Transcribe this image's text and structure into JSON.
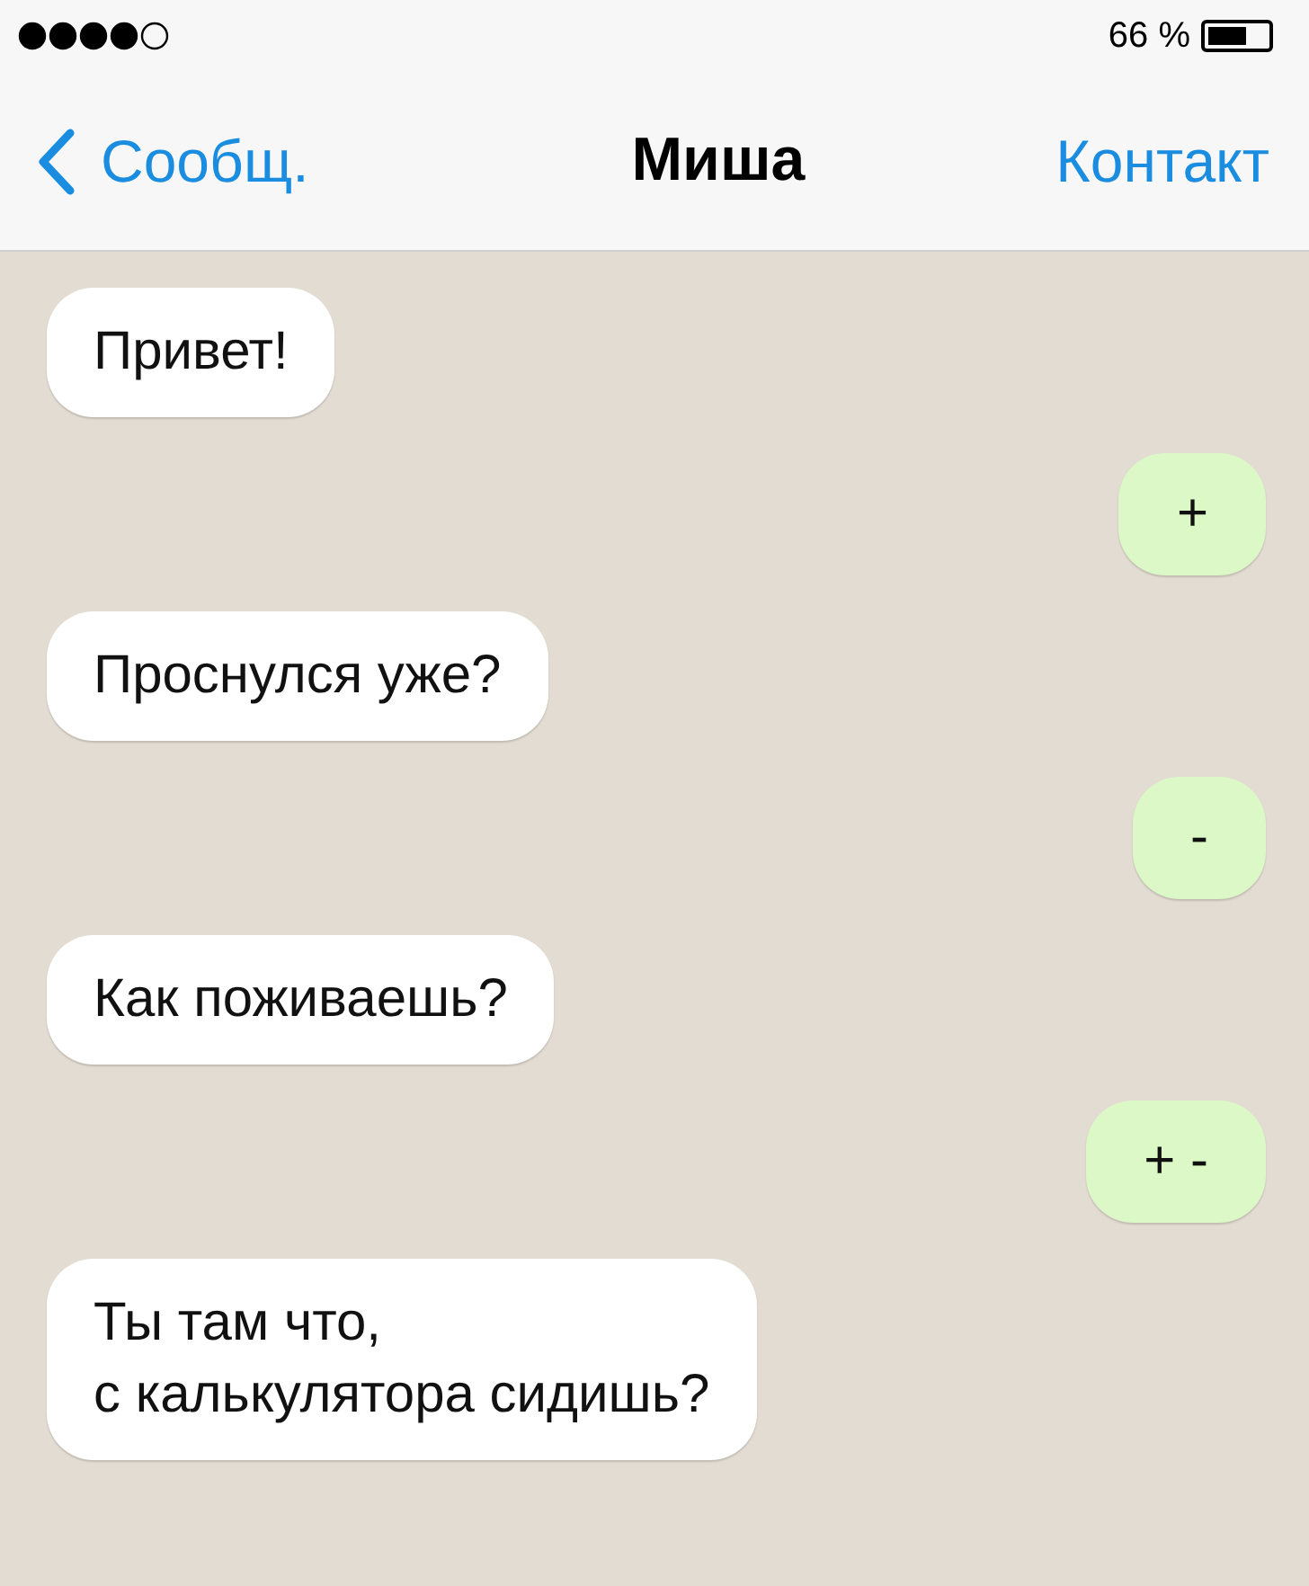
{
  "status_bar": {
    "battery_text": "66 %"
  },
  "nav": {
    "back_label": "Сообщ.",
    "title": "Миша",
    "action_label": "Контакт"
  },
  "messages": [
    {
      "kind": "incoming",
      "text": "Привет!"
    },
    {
      "kind": "outgoing",
      "text": "+"
    },
    {
      "kind": "incoming",
      "text": "Проснулся уже?"
    },
    {
      "kind": "outgoing",
      "text": "-"
    },
    {
      "kind": "incoming",
      "text": "Как поживаешь?"
    },
    {
      "kind": "outgoing",
      "text": "+ -"
    },
    {
      "kind": "incoming",
      "text": "Ты там что,\nс калькулятора сидишь?"
    }
  ]
}
